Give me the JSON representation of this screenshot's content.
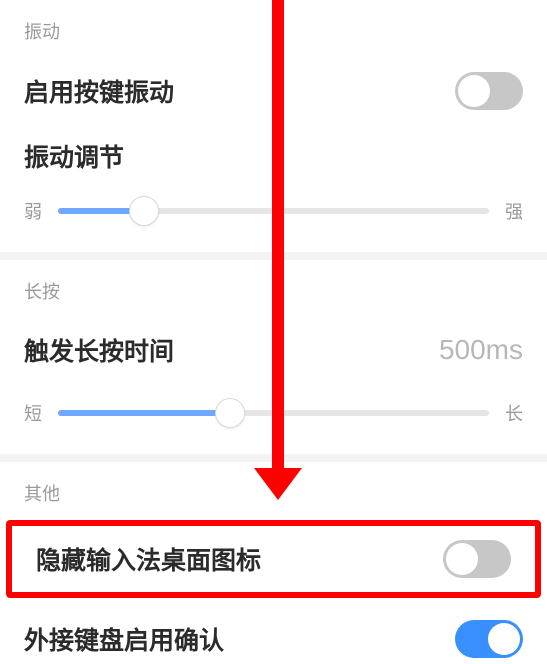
{
  "sections": {
    "vibration": {
      "header": "振动",
      "enable_label": "启用按键振动",
      "enable_on": false,
      "adjust_label": "振动调节",
      "slider": {
        "min_label": "弱",
        "max_label": "强",
        "percent": 20
      }
    },
    "longpress": {
      "header": "长按",
      "trigger_label": "触发长按时间",
      "trigger_value": "500ms",
      "slider": {
        "min_label": "短",
        "max_label": "长",
        "percent": 40
      }
    },
    "other": {
      "header": "其他",
      "hide_icon_label": "隐藏输入法桌面图标",
      "hide_icon_on": false,
      "ext_kb_label": "外接键盘启用确认",
      "ext_kb_on": true
    }
  },
  "annotation": {
    "arrow_color": "#ff0000",
    "highlight_target": "hide-ime-icon-row"
  }
}
